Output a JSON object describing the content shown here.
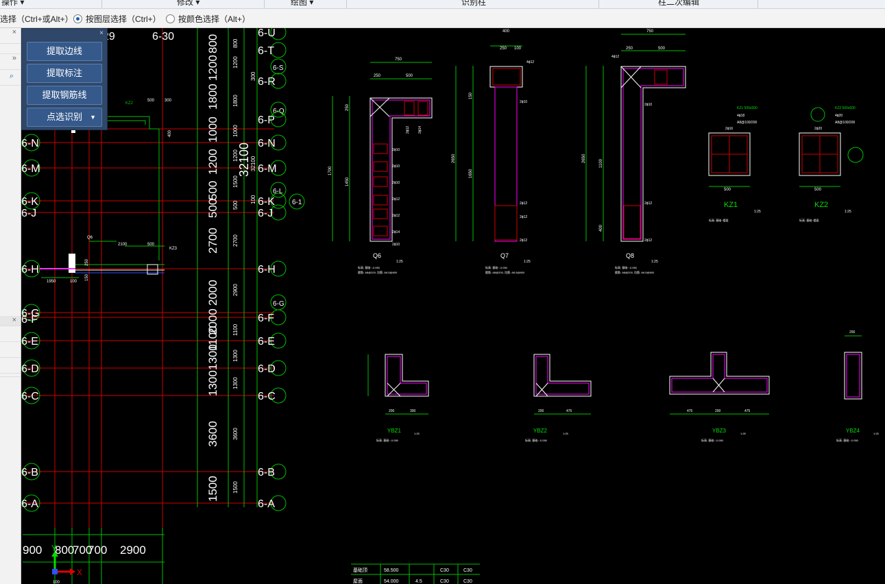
{
  "menu": {
    "items": [
      "操作 ▾",
      "修改 ▾",
      "绘图 ▾",
      "识别柱",
      "柱二次编辑"
    ]
  },
  "options": {
    "opt1": "选择（Ctrl+或Alt+）",
    "opt2": "按图层选择（Ctrl+）",
    "opt3": "按颜色选择（Alt+）",
    "selected": "按图层选择（Ctrl+）"
  },
  "float_panel": {
    "buttons": [
      "提取边线",
      "提取标注",
      "提取钢筋线",
      "点选识别"
    ]
  },
  "axes": {
    "top": [
      "29",
      "6-30"
    ],
    "left": [
      "6-N",
      "6-M",
      "6-K",
      "6-J",
      "6-H",
      "6-G",
      "6-F",
      "6-E",
      "6-D",
      "6-C",
      "6-B",
      "6-A"
    ],
    "right": [
      "6-U",
      "6-T",
      "6-S",
      "6-R",
      "6-Q",
      "6-P",
      "6-N",
      "6-M",
      "6-L",
      "6-K",
      "6-J",
      "6-H",
      "6-G",
      "6-F",
      "6-E",
      "6-D",
      "6-C",
      "6-B",
      "6-A"
    ],
    "big_dims": [
      "800",
      "1200",
      "1800",
      "1000",
      "1200",
      "500",
      "500",
      "2700",
      "2000",
      "2000",
      "1100",
      "1300",
      "1300",
      "3600",
      "1500"
    ],
    "small_dims": [
      "800",
      "1200",
      "300",
      "1800",
      "1000",
      "1200",
      "1500",
      "500",
      "100",
      "2700",
      "2900",
      "1100",
      "1300",
      "1300",
      "3600",
      "1500"
    ],
    "total": "32100",
    "total_small": "32100",
    "bottom": [
      "900",
      "800",
      "700",
      "700",
      "2900"
    ],
    "near_mark": "6-1"
  },
  "columns": [
    {
      "name": "Q6",
      "scale": "1:25",
      "w1": "750",
      "w2": "250",
      "w3": "500",
      "h1": "1700",
      "h2": "1450",
      "h3": "250",
      "bars": [
        "2ϕ10",
        "2ϕ10",
        "2ϕ10",
        "2ϕ12",
        "2ϕ12",
        "2ϕ14",
        "2ϕ10",
        "2ϕ12",
        "2ϕ14"
      ],
      "note1": "标高: 基础~-0.050",
      "note2": "箍筋: A8@200, 拉筋: A6.5@600"
    },
    {
      "name": "Q7",
      "scale": "1:25",
      "w1": "400",
      "w2": "250",
      "w3": "100",
      "h1": "2650",
      "h2": "1650",
      "h3": "150",
      "bars": [
        "4ϕ12",
        "2ϕ10",
        "2ϕ12",
        "2ϕ12",
        "2ϕ12"
      ],
      "note1": "标高: 基础~-0.050",
      "note2": "箍筋: A8@200, 拉筋: A6.5@600"
    },
    {
      "name": "Q8",
      "scale": "1:25",
      "w1": "750",
      "w2": "250",
      "w3": "500",
      "h1": "2650",
      "h2": "1100",
      "h3": "400",
      "bars": [
        "4ϕ12",
        "2ϕ10",
        "2ϕ12",
        "2ϕ12"
      ],
      "note1": "标高: 基础~-0.050",
      "note2": "箍筋: A8@200, 拉筋: A6.5@600"
    },
    {
      "name": "KZ1",
      "scale": "1:25",
      "spec": "KZ1 500x500",
      "bars": "4ϕ18",
      "stir": "A8@100/200",
      "side": "2ϕ16",
      "dim": "500",
      "note": "标高: 基础~楼面"
    },
    {
      "name": "KZ2",
      "scale": "1:25",
      "spec": "KZ2 500x500",
      "bars": "4ϕ20",
      "stir": "A8@100/200",
      "side": "2ϕ20",
      "dim": "500",
      "note": "标高: 基础~楼面"
    },
    {
      "name": "YBZ1",
      "scale": "1:25",
      "d1": "200",
      "d2": "300",
      "note": "标高: 基础~-0.050"
    },
    {
      "name": "YBZ2",
      "scale": "1:25",
      "d1": "200",
      "d2": "475",
      "note": "标高: 基础~-0.050"
    },
    {
      "name": "YBZ3",
      "scale": "1:25",
      "d1": "475",
      "d2": "200",
      "d3": "475",
      "note": "标高: 基础~-0.050"
    },
    {
      "name": "YBZ4",
      "scale": "1:25",
      "d1": "200",
      "note": "标高: 基础~-0.050"
    }
  ],
  "table": {
    "rows": [
      [
        "基础顶",
        "58.500",
        "",
        "C30",
        "C30"
      ],
      [
        "屋面",
        "54.000",
        "4.5",
        "C30",
        "C30"
      ]
    ]
  },
  "left_details": {
    "kz2": "KZ2",
    "q6": "Q6",
    "kz3": "KZ3",
    "d500": "500",
    "d300": "300",
    "d400": "400",
    "d2100": "2100",
    "d500b": "500",
    "d1950": "1950",
    "d100": "100",
    "d250": "250",
    "d150": "150"
  },
  "ucs": {
    "x": "X",
    "y": "Y",
    "origin": "100"
  },
  "colors": {
    "green": "#00e000",
    "red": "#e00000",
    "white": "#ffffff",
    "magenta": "#ff00ff",
    "panel": "#2f4769"
  }
}
